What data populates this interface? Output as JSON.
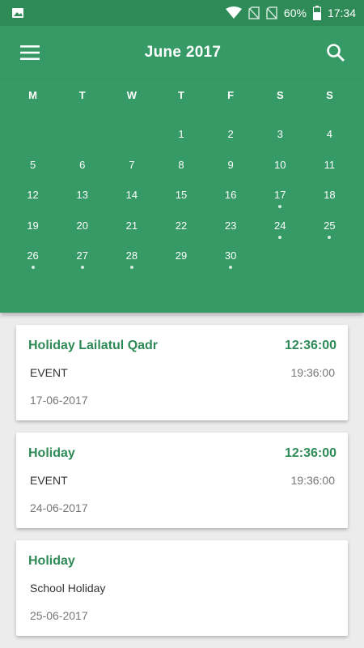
{
  "status_bar": {
    "battery": "60%",
    "time": "17:34",
    "icons": [
      "image-icon",
      "wifi-icon",
      "no-sim-icon",
      "no-sim-icon",
      "battery-icon"
    ]
  },
  "app_bar": {
    "title": "June 2017",
    "menu_icon": "menu-icon",
    "search_icon": "search-icon"
  },
  "calendar": {
    "weekdays": [
      "M",
      "T",
      "W",
      "T",
      "F",
      "S",
      "S"
    ],
    "leading_blanks": 3,
    "days": [
      {
        "label": "1",
        "event": false
      },
      {
        "label": "2",
        "event": false
      },
      {
        "label": "3",
        "event": false
      },
      {
        "label": "4",
        "event": false
      },
      {
        "label": "5",
        "event": false
      },
      {
        "label": "6",
        "event": false
      },
      {
        "label": "7",
        "event": false
      },
      {
        "label": "8",
        "event": false
      },
      {
        "label": "9",
        "event": false
      },
      {
        "label": "10",
        "event": false
      },
      {
        "label": "11",
        "event": false
      },
      {
        "label": "12",
        "event": false
      },
      {
        "label": "13",
        "event": false
      },
      {
        "label": "14",
        "event": false
      },
      {
        "label": "15",
        "event": false
      },
      {
        "label": "16",
        "event": false
      },
      {
        "label": "17",
        "event": true
      },
      {
        "label": "18",
        "event": false
      },
      {
        "label": "19",
        "event": false
      },
      {
        "label": "20",
        "event": false
      },
      {
        "label": "21",
        "event": false
      },
      {
        "label": "22",
        "event": false
      },
      {
        "label": "23",
        "event": false
      },
      {
        "label": "24",
        "event": true
      },
      {
        "label": "25",
        "event": true
      },
      {
        "label": "26",
        "event": true
      },
      {
        "label": "27",
        "event": true
      },
      {
        "label": "28",
        "event": true
      },
      {
        "label": "29",
        "event": false
      },
      {
        "label": "30",
        "event": true
      }
    ]
  },
  "events": [
    {
      "title": "Holiday Lailatul Qadr",
      "start": "12:36:00",
      "type": "EVENT",
      "end": "19:36:00",
      "date": "17-06-2017"
    },
    {
      "title": "Holiday",
      "start": "12:36:00",
      "type": "EVENT",
      "end": "19:36:00",
      "date": "24-06-2017"
    },
    {
      "title": "Holiday",
      "start": "",
      "type": "School Holiday",
      "end": "",
      "date": "25-06-2017"
    }
  ],
  "colors": {
    "primary": "#359a65",
    "primary_dark": "#2e8b57",
    "accent_text": "#2e8b57"
  }
}
